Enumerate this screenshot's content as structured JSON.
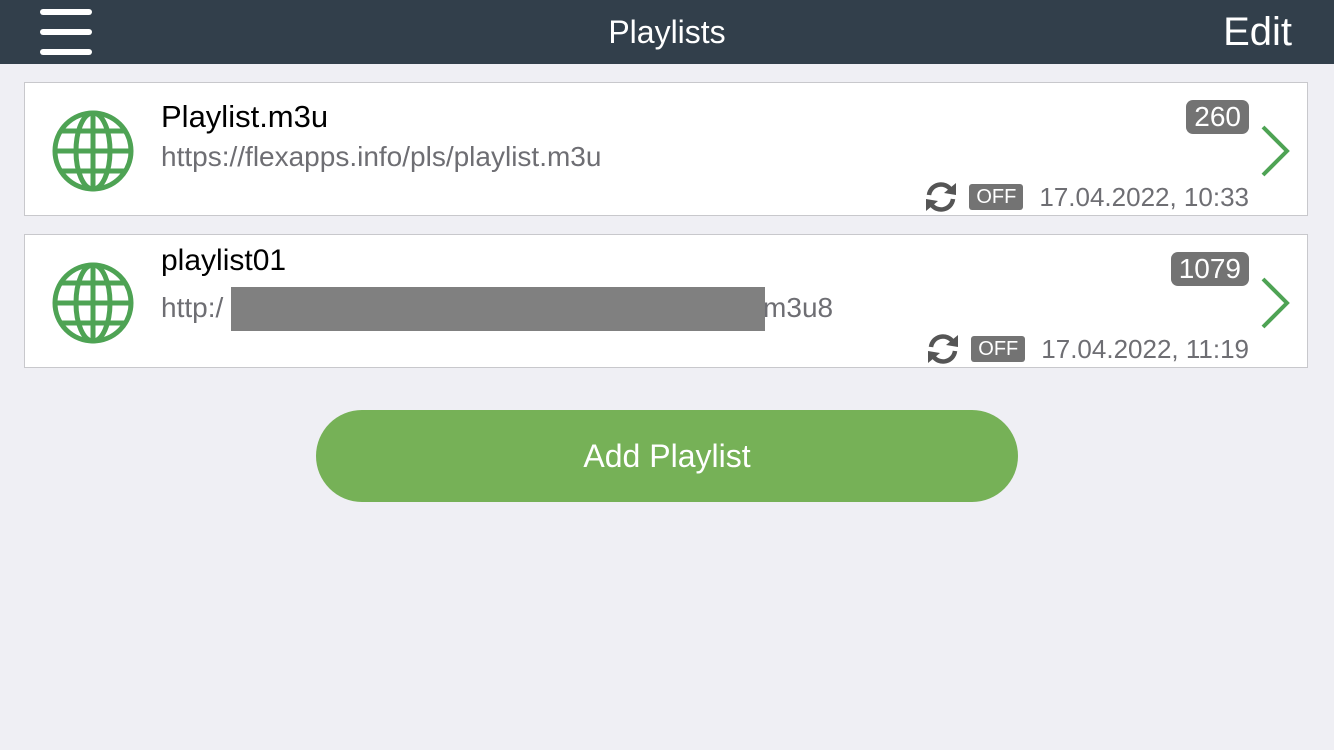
{
  "navbar": {
    "title": "Playlists",
    "edit_label": "Edit",
    "menu_icon": "hamburger-menu-icon",
    "background": "#323f4b"
  },
  "playlists": [
    {
      "name": "Playlist.m3u",
      "url": "https://flexapps.info/pls/playlist.m3u",
      "count": "260",
      "sync_status": "OFF",
      "date": "17.04.2022, 10:33"
    },
    {
      "name": "playlist01",
      "url_prefix": "http:/",
      "url_suffix": ".m3u8",
      "count": "1079",
      "sync_status": "OFF",
      "date": "17.04.2022, 11:19"
    }
  ],
  "add_button": {
    "label": "Add Playlist",
    "color": "#76b157"
  },
  "colors": {
    "accent": "#4ea354",
    "background": "#efeff4",
    "badge": "#737373"
  },
  "icons": {
    "playlist": "globe-icon",
    "open": "chevron-right-icon",
    "sync": "refresh-icon"
  }
}
